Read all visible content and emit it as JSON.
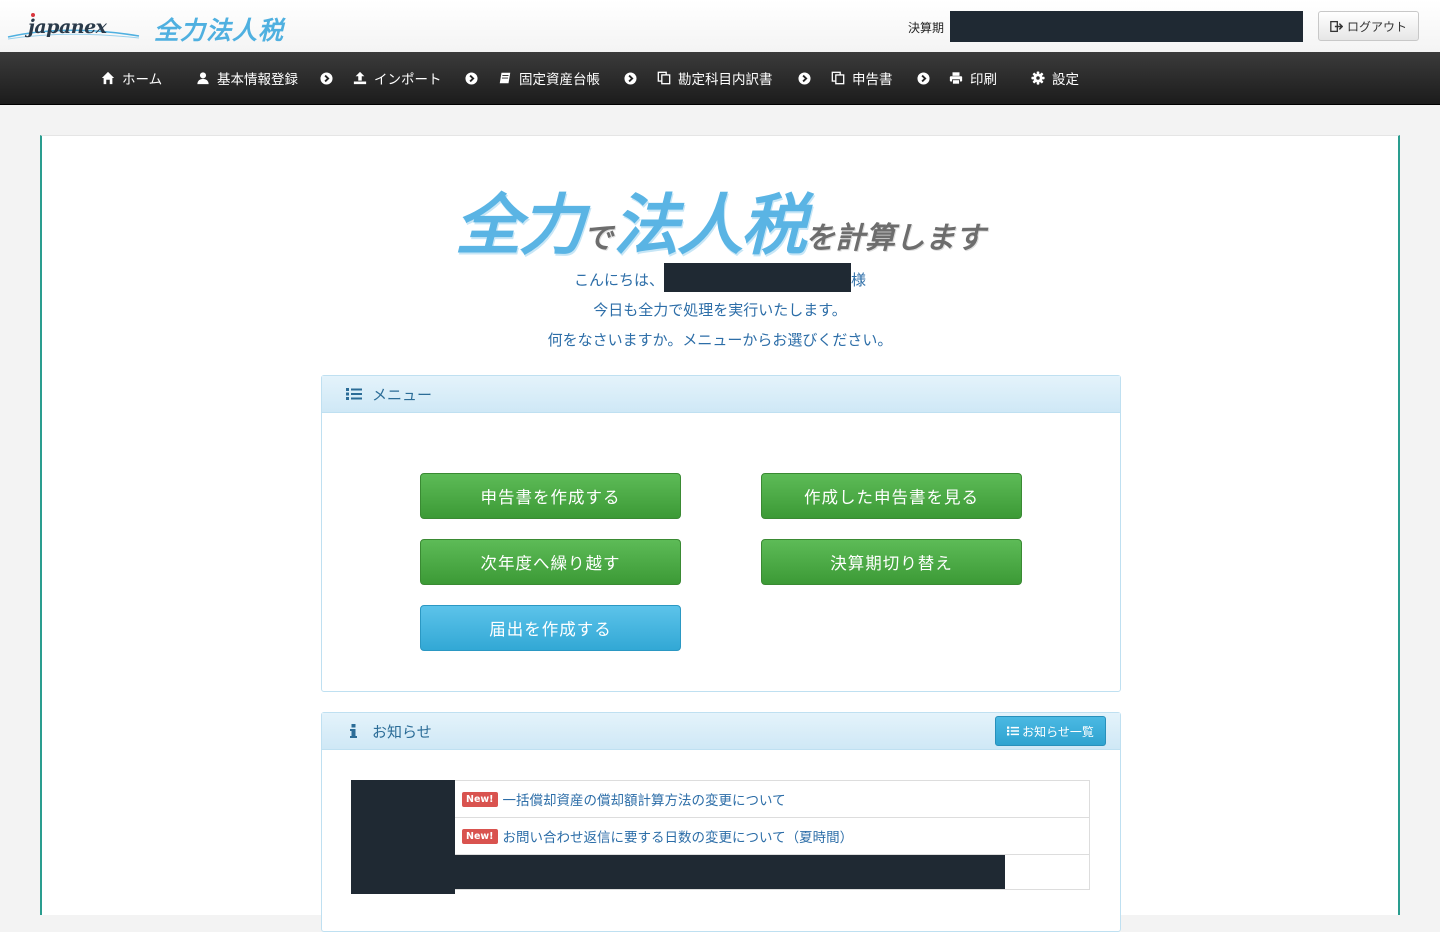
{
  "header": {
    "brand": "japanex",
    "product": "全力法人税",
    "period_label": "決算期",
    "period_value": "",
    "logout_label": "ログアウト"
  },
  "nav": {
    "items": [
      {
        "label": "ホーム",
        "icon": "home-icon"
      },
      {
        "label": "基本情報登録",
        "icon": "user-icon"
      },
      {
        "label": "インポート",
        "icon": "upload-icon"
      },
      {
        "label": "固定資産台帳",
        "icon": "book-icon"
      },
      {
        "label": "勘定科目内訳書",
        "icon": "copy-icon"
      },
      {
        "label": "申告書",
        "icon": "copy-icon"
      },
      {
        "label": "印刷",
        "icon": "print-icon"
      },
      {
        "label": "設定",
        "icon": "gear-icon"
      }
    ]
  },
  "hero": {
    "title_main_1": "全力",
    "title_de": "で",
    "title_main_2": "法人税",
    "title_tail": "を計算します"
  },
  "greeting": {
    "line1_prefix": "こんにちは、",
    "user_name": "",
    "line1_suffix": "様",
    "line2": "今日も全力で処理を実行いたします。",
    "line3": "何をなさいますか。メニューからお選びください。"
  },
  "menu": {
    "title": "メニュー",
    "buttons": {
      "create_return": "申告書を作成する",
      "view_returns": "作成した申告書を見る",
      "carry_forward": "次年度へ繰り越す",
      "switch_period": "決算期切り替え",
      "create_notification": "届出を作成する"
    }
  },
  "notices": {
    "title": "お知らせ",
    "all_label": "お知らせ一覧",
    "badge": "New!",
    "items": [
      {
        "date": "",
        "title": "一括償却資産の償却額計算方法の変更について"
      },
      {
        "date": "",
        "title": "お問い合わせ返信に要する日数の変更について（夏時間）"
      },
      {
        "date": "",
        "title": ""
      }
    ]
  },
  "colors": {
    "nav_bg": "#2b2b2b",
    "accent_blue": "#5ab4e4",
    "button_green": "#4aa944",
    "button_blue": "#3fb3e0",
    "link_blue": "#2d6ea8",
    "border_teal": "#2a9d8f"
  }
}
